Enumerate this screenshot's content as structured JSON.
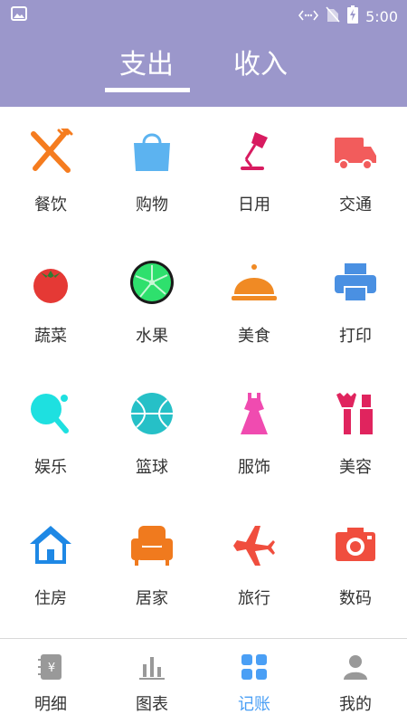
{
  "status_bar": {
    "time": "5:00"
  },
  "tabs": {
    "expense": "支出",
    "income": "收入"
  },
  "categories": [
    {
      "label": "餐饮",
      "icon": "fork-knife-icon",
      "color": "#f57c1f"
    },
    {
      "label": "购物",
      "icon": "shopping-bag-icon",
      "color": "#5cb3f0"
    },
    {
      "label": "日用",
      "icon": "desk-lamp-icon",
      "color": "#d81b60"
    },
    {
      "label": "交通",
      "icon": "truck-icon",
      "color": "#f25c5c"
    },
    {
      "label": "蔬菜",
      "icon": "tomato-icon",
      "color": "#e53935"
    },
    {
      "label": "水果",
      "icon": "lime-icon",
      "color": "#2ee06d"
    },
    {
      "label": "美食",
      "icon": "food-cloche-icon",
      "color": "#f08a24"
    },
    {
      "label": "打印",
      "icon": "printer-icon",
      "color": "#4a90e2"
    },
    {
      "label": "娱乐",
      "icon": "ping-pong-icon",
      "color": "#1ee0e0"
    },
    {
      "label": "篮球",
      "icon": "basketball-icon",
      "color": "#26c0c7"
    },
    {
      "label": "服饰",
      "icon": "dress-icon",
      "color": "#f04bb0"
    },
    {
      "label": "美容",
      "icon": "makeup-brush-icon",
      "color": "#e0245e"
    },
    {
      "label": "住房",
      "icon": "house-icon",
      "color": "#1e88e5"
    },
    {
      "label": "居家",
      "icon": "sofa-icon",
      "color": "#f07a1e"
    },
    {
      "label": "旅行",
      "icon": "airplane-icon",
      "color": "#f04e3e"
    },
    {
      "label": "数码",
      "icon": "camera-icon",
      "color": "#f04e3e"
    }
  ],
  "bottom_nav": {
    "items": [
      {
        "label": "明细",
        "icon": "ledger-icon",
        "active": false
      },
      {
        "label": "图表",
        "icon": "bar-chart-icon",
        "active": false
      },
      {
        "label": "记账",
        "icon": "grid-icon",
        "active": true
      },
      {
        "label": "我的",
        "icon": "person-icon",
        "active": false
      }
    ],
    "active_color": "#4a9ff5",
    "inactive_color": "#999999"
  },
  "colors": {
    "header": "#9b97cb"
  }
}
